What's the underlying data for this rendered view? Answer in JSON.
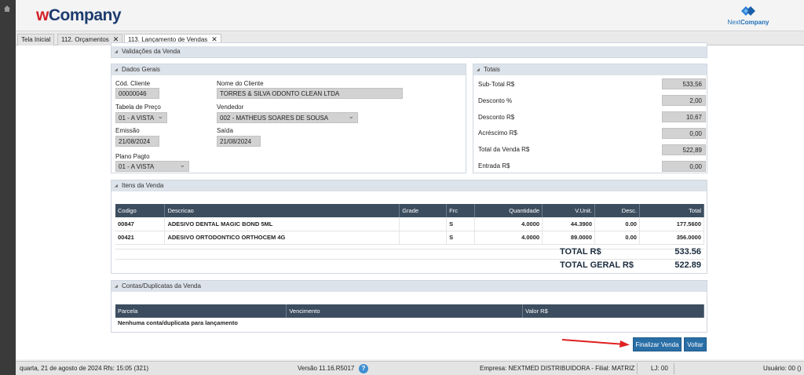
{
  "header": {
    "logo_prefix": "w",
    "logo_rest": "Company",
    "nc_logo_next": "Next",
    "nc_logo_company": "Company"
  },
  "tabs": [
    {
      "label": "Tela Inicial"
    },
    {
      "label": "112. Orçamentos",
      "close": "✕"
    },
    {
      "label": "113. Lançamento de Vendas",
      "close": "✕"
    }
  ],
  "validacoes": {
    "title": "Validações da Venda"
  },
  "dados_gerais": {
    "title": "Dados Gerais",
    "cod_cliente_label": "Cód. Cliente",
    "cod_cliente": "00000046",
    "nome_cliente_label": "Nome do Cliente",
    "nome_cliente": "TORRES & SILVA ODONTO CLEAN LTDA",
    "tabela_preco_label": "Tabela de Preço",
    "tabela_preco": "01 - A VISTA",
    "vendedor_label": "Vendedor",
    "vendedor": "002 - MATHEUS SOARES DE SOUSA",
    "emissao_label": "Emissão",
    "emissao": "21/08/2024",
    "saida_label": "Saída",
    "saida": "21/08/2024",
    "plano_pagto_label": "Plano Pagto",
    "plano_pagto": "01 - A VISTA"
  },
  "totais": {
    "title": "Totais",
    "subtotal_label": "Sub-Total R$",
    "subtotal": "533,56",
    "desconto_pct_label": "Desconto %",
    "desconto_pct": "2,00",
    "desconto_rs_label": "Desconto R$",
    "desconto_rs": "10,67",
    "acrescimo_label": "Acréscimo R$",
    "acrescimo": "0,00",
    "total_venda_label": "Total da Venda R$",
    "total_venda": "522,89",
    "entrada_label": "Entrada R$",
    "entrada": "0,00"
  },
  "itens": {
    "title": "Itens da Venda",
    "columns": [
      "Codigo",
      "Descricao",
      "Grade",
      "Frc",
      "Quantidade",
      "V.Unit.",
      "Desc.",
      "Total"
    ],
    "rows": [
      [
        "00847",
        "ADESIVO DENTAL MAGIC BOND 5ML",
        "",
        "S",
        "4.0000",
        "44.3900",
        "0.00",
        "177.5600"
      ],
      [
        "00421",
        "ADESIVO ORTODONTICO ORTHOCEM 4G",
        "",
        "S",
        "4.0000",
        "89.0000",
        "0.00",
        "356.0000"
      ]
    ],
    "total_label": "TOTAL R$",
    "total_value": "533.56",
    "total_geral_label": "TOTAL GERAL R$",
    "total_geral_value": "522.89"
  },
  "contas": {
    "title": "Contas/Duplicatas da Venda",
    "columns": [
      "Parcela",
      "Vencimento",
      "Valor R$"
    ],
    "empty_text": "Nenhuma conta/duplicata para lançamento"
  },
  "actions": {
    "finalizar": "Finalizar Venda",
    "voltar": "Voltar"
  },
  "status": {
    "date_time": "quarta, 21 de agosto de 2024  Rfs: 15:05 (321)",
    "version": "Versão 11.16.R5017",
    "help": "?",
    "empresa": "Empresa: NEXTMED DISTRIBUIDORA - Filial: MATRIZ",
    "loja": "LJ: 00",
    "usuario": "Usuário: 00 ()"
  },
  "colors": {
    "accent": "#2a6ea6",
    "arrow": "#e02020",
    "grid_header": "#3c4d5f"
  }
}
